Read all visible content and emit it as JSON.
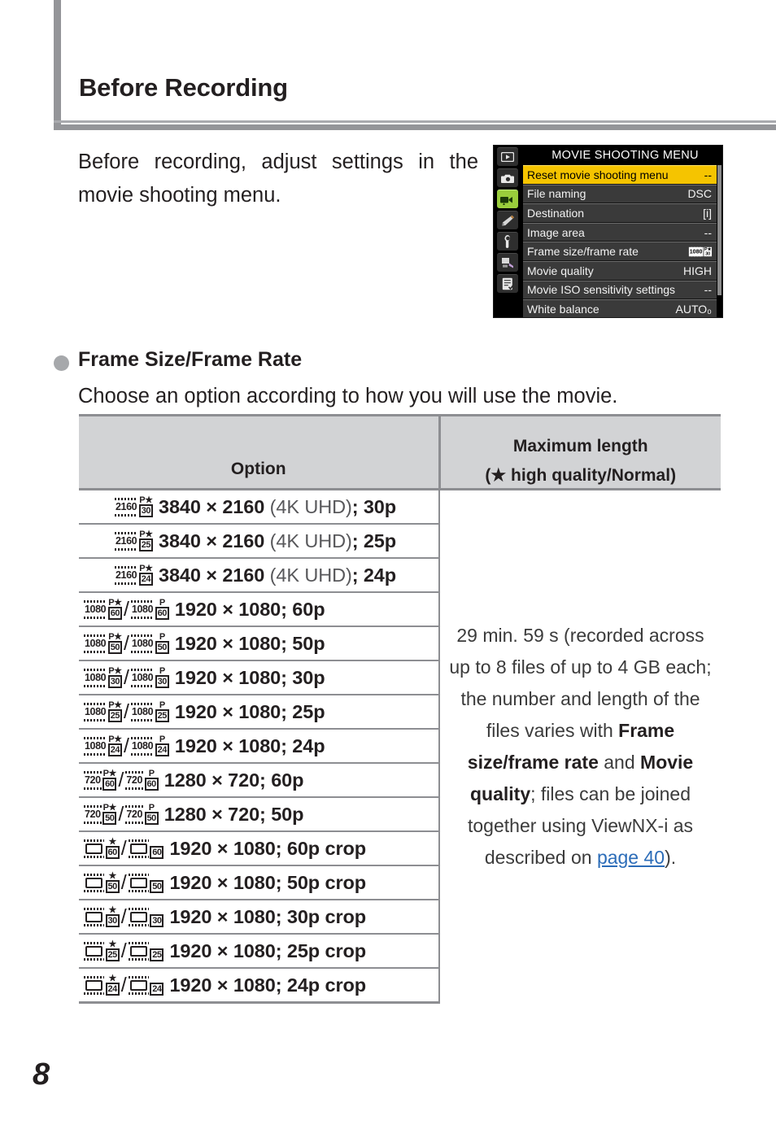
{
  "header": {
    "title": "Before Recording"
  },
  "intro": {
    "paragraph": "Before recording, adjust settings in the movie shooting menu."
  },
  "camera_menu": {
    "title": "MOVIE SHOOTING MENU",
    "sidebar_icons": [
      "playback-icon",
      "photo-shooting-icon",
      "movie-shooting-icon",
      "custom-settings-pencil-icon",
      "setup-wrench-icon",
      "retouch-brush-icon",
      "my-menu-checklist-icon"
    ],
    "items": [
      {
        "label": "Reset movie shooting menu",
        "value": "--",
        "highlighted": true
      },
      {
        "label": "File naming",
        "value": "DSC",
        "highlighted": false
      },
      {
        "label": "Destination",
        "value": "[i]",
        "highlighted": false
      },
      {
        "label": "Image area",
        "value": "--",
        "highlighted": false
      },
      {
        "label": "Frame size/frame rate",
        "value": "1080 P★ 30",
        "highlighted": false
      },
      {
        "label": "Movie quality",
        "value": "HIGH",
        "highlighted": false
      },
      {
        "label": "Movie ISO sensitivity settings",
        "value": "--",
        "highlighted": false
      },
      {
        "label": "White balance",
        "value": "AUTO₀",
        "highlighted": false
      }
    ]
  },
  "section": {
    "bullet_title": "Frame Size/Frame Rate",
    "subtitle": "Choose an option according to how you will use the movie."
  },
  "table": {
    "headers": {
      "option": "Option",
      "max_length_line1": "Maximum length",
      "max_length_line2": "(★ high quality/Normal)"
    },
    "max_length": {
      "part1": "29 min. 59 s (recorded across up to 8 files of up to 4 GB each; the number and length of the files varies with ",
      "bold1": "Frame size/frame rate",
      "mid": " and ",
      "bold2": "Movie quality",
      "part2": "; files can be joined together using ViewNX-i as described on ",
      "link": "page 40",
      "end": ")."
    },
    "rows": [
      {
        "icons": [
          {
            "strip": "2160",
            "crop": false,
            "top": "P★",
            "bot": "30"
          }
        ],
        "label_bold1": "3840 × 2160",
        "label_light": " (4K UHD)",
        "label_bold2": "; 30p"
      },
      {
        "icons": [
          {
            "strip": "2160",
            "crop": false,
            "top": "P★",
            "bot": "25"
          }
        ],
        "label_bold1": "3840 × 2160",
        "label_light": " (4K UHD)",
        "label_bold2": "; 25p"
      },
      {
        "icons": [
          {
            "strip": "2160",
            "crop": false,
            "top": "P★",
            "bot": "24"
          }
        ],
        "label_bold1": "3840 × 2160",
        "label_light": " (4K UHD)",
        "label_bold2": "; 24p"
      },
      {
        "icons": [
          {
            "strip": "1080",
            "crop": false,
            "top": "P★",
            "bot": "60"
          },
          {
            "strip": "1080",
            "crop": false,
            "top": "P",
            "bot": "60"
          }
        ],
        "label_bold1": "1920 × 1080; 60p",
        "label_light": "",
        "label_bold2": ""
      },
      {
        "icons": [
          {
            "strip": "1080",
            "crop": false,
            "top": "P★",
            "bot": "50"
          },
          {
            "strip": "1080",
            "crop": false,
            "top": "P",
            "bot": "50"
          }
        ],
        "label_bold1": "1920 × 1080; 50p",
        "label_light": "",
        "label_bold2": ""
      },
      {
        "icons": [
          {
            "strip": "1080",
            "crop": false,
            "top": "P★",
            "bot": "30"
          },
          {
            "strip": "1080",
            "crop": false,
            "top": "P",
            "bot": "30"
          }
        ],
        "label_bold1": "1920 × 1080; 30p",
        "label_light": "",
        "label_bold2": ""
      },
      {
        "icons": [
          {
            "strip": "1080",
            "crop": false,
            "top": "P★",
            "bot": "25"
          },
          {
            "strip": "1080",
            "crop": false,
            "top": "P",
            "bot": "25"
          }
        ],
        "label_bold1": "1920 × 1080; 25p",
        "label_light": "",
        "label_bold2": ""
      },
      {
        "icons": [
          {
            "strip": "1080",
            "crop": false,
            "top": "P★",
            "bot": "24"
          },
          {
            "strip": "1080",
            "crop": false,
            "top": "P",
            "bot": "24"
          }
        ],
        "label_bold1": "1920 × 1080; 24p",
        "label_light": "",
        "label_bold2": ""
      },
      {
        "icons": [
          {
            "strip": "720",
            "crop": false,
            "top": "P★",
            "bot": "60"
          },
          {
            "strip": "720",
            "crop": false,
            "top": "P",
            "bot": "60"
          }
        ],
        "label_bold1": "1280 × 720; 60p",
        "label_light": "",
        "label_bold2": ""
      },
      {
        "icons": [
          {
            "strip": "720",
            "crop": false,
            "top": "P★",
            "bot": "50"
          },
          {
            "strip": "720",
            "crop": false,
            "top": "P",
            "bot": "50"
          }
        ],
        "label_bold1": "1280 × 720; 50p",
        "label_light": "",
        "label_bold2": ""
      },
      {
        "icons": [
          {
            "strip": "",
            "crop": true,
            "top": "★",
            "bot": "60"
          },
          {
            "strip": "",
            "crop": true,
            "top": "",
            "bot": "60"
          }
        ],
        "label_bold1": "1920 × 1080; 60p crop",
        "label_light": "",
        "label_bold2": ""
      },
      {
        "icons": [
          {
            "strip": "",
            "crop": true,
            "top": "★",
            "bot": "50"
          },
          {
            "strip": "",
            "crop": true,
            "top": "",
            "bot": "50"
          }
        ],
        "label_bold1": "1920 × 1080; 50p crop",
        "label_light": "",
        "label_bold2": ""
      },
      {
        "icons": [
          {
            "strip": "",
            "crop": true,
            "top": "★",
            "bot": "30"
          },
          {
            "strip": "",
            "crop": true,
            "top": "",
            "bot": "30"
          }
        ],
        "label_bold1": "1920 × 1080; 30p crop",
        "label_light": "",
        "label_bold2": ""
      },
      {
        "icons": [
          {
            "strip": "",
            "crop": true,
            "top": "★",
            "bot": "25"
          },
          {
            "strip": "",
            "crop": true,
            "top": "",
            "bot": "25"
          }
        ],
        "label_bold1": "1920 × 1080; 25p crop",
        "label_light": "",
        "label_bold2": ""
      },
      {
        "icons": [
          {
            "strip": "",
            "crop": true,
            "top": "★",
            "bot": "24"
          },
          {
            "strip": "",
            "crop": true,
            "top": "",
            "bot": "24"
          }
        ],
        "label_bold1": "1920 × 1080; 24p crop",
        "label_light": "",
        "label_bold2": ""
      }
    ]
  },
  "footer": {
    "page_number": "8"
  },
  "colors": {
    "rule": "#949599",
    "table_header_bg": "#d2d3d5",
    "table_border": "#8d8e92",
    "link": "#2b6cb8",
    "menu_highlight": "#f5c400",
    "menu_selected_tab": "#9ace3c"
  }
}
